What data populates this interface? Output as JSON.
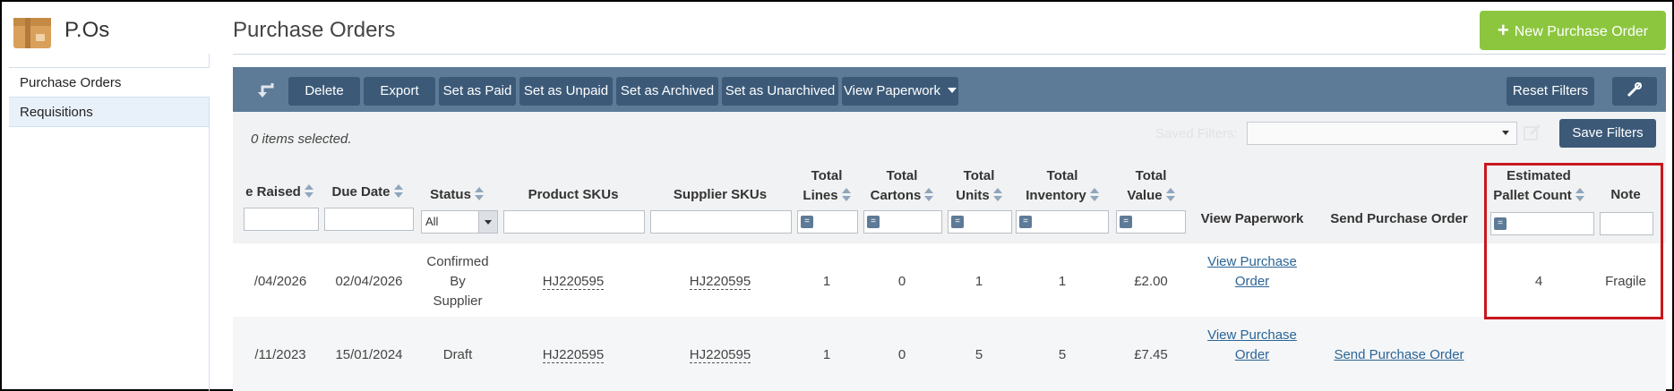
{
  "app": {
    "title": "P.Os"
  },
  "sidebar": {
    "items": [
      {
        "label": "Purchase Orders"
      },
      {
        "label": "Requisitions"
      }
    ]
  },
  "header": {
    "page_title": "Purchase Orders",
    "new_button": "New Purchase Order"
  },
  "toolbar": {
    "buttons": [
      "Delete",
      "Export",
      "Set as Paid",
      "Set as Unpaid",
      "Set as Archived",
      "Set as Unarchived",
      "View Paperwork"
    ],
    "reset_filters": "Reset Filters"
  },
  "selection": {
    "text": "0 items selected."
  },
  "saved_filters": {
    "label": "Saved Filters:",
    "value": "",
    "save_button": "Save Filters"
  },
  "table": {
    "columns": {
      "date_raised": "e Raised",
      "due_date": "Due Date",
      "status": "Status",
      "product_skus": "Product SKUs",
      "supplier_skus": "Supplier SKUs",
      "total_lines": [
        "Total",
        "Lines"
      ],
      "total_cartons": [
        "Total",
        "Cartons"
      ],
      "total_units": [
        "Total",
        "Units"
      ],
      "total_inventory": [
        "Total",
        "Inventory"
      ],
      "total_value": [
        "Total",
        "Value"
      ],
      "view_paperwork": "View Paperwork",
      "send_po": "Send Purchase Order",
      "pallet_count": [
        "Estimated",
        "Pallet Count"
      ],
      "note": "Note"
    },
    "status_filter": "All",
    "rows": [
      {
        "date_raised": "/04/2026",
        "due_date": "02/04/2026",
        "status": [
          "Confirmed",
          "By",
          "Supplier"
        ],
        "product_sku": "HJ220595",
        "supplier_sku": "HJ220595",
        "total_lines": "1",
        "total_cartons": "0",
        "total_units": "1",
        "total_inventory": "1",
        "total_value": "£2.00",
        "view_paperwork": [
          "View Purchase",
          "Order"
        ],
        "send_po": "",
        "pallet_count": "4",
        "note": "Fragile"
      },
      {
        "date_raised": "/11/2023",
        "due_date": "15/01/2024",
        "status": [
          "Draft"
        ],
        "product_sku": "HJ220595",
        "supplier_sku": "HJ220595",
        "total_lines": "1",
        "total_cartons": "0",
        "total_units": "5",
        "total_inventory": "5",
        "total_value": "£7.45",
        "view_paperwork": [
          "View Purchase",
          "Order"
        ],
        "send_po": "Send Purchase Order",
        "pallet_count": "",
        "note": ""
      }
    ]
  },
  "colors": {
    "accent_green": "#8cc63f",
    "toolbar_bg": "#5d7a97",
    "button_bg": "#3c5a78",
    "highlight": "#c8171e",
    "link": "#2a6496"
  }
}
